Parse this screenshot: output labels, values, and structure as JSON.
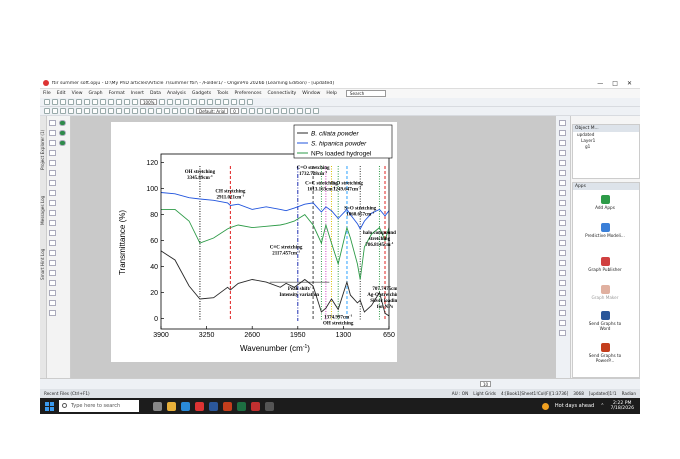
{
  "window": {
    "title": "ftir summer soft.opju - D:\\My PhD articles\\Article 7\\summer ftir\\ - /Folder1/ - OriginPro 2026b (Learning Edition) - [updated]",
    "min": "—",
    "max": "□",
    "close": "✕"
  },
  "menu": {
    "items": [
      "File",
      "Edit",
      "View",
      "Graph",
      "Format",
      "Insert",
      "Data",
      "Analysis",
      "Gadgets",
      "Tools",
      "Preferences",
      "Connectivity",
      "Window",
      "Help"
    ],
    "search_placeholder": "Search"
  },
  "toolbar": {
    "zoom": "100%",
    "font": "Default: Arial",
    "font_size": "0"
  },
  "left_tabs": [
    "Project Explorer (1)",
    "Messages Log",
    "Smart Hint Log"
  ],
  "object_manager": {
    "title": "Object M...",
    "nodes": [
      "updated",
      "Layer1",
      "g1",
      "",
      "",
      "",
      ""
    ]
  },
  "apps": {
    "title": "Apps",
    "items": [
      "Add Apps",
      "Predictive Modeli...",
      "Graph Publisher",
      "Graph Maker",
      "Send Graphs to Word",
      "Send Graphs to PowerP..."
    ]
  },
  "bottom": {
    "zoom_value": "10"
  },
  "status": {
    "left": "Recent Files (Ctrl+F1)",
    "items": [
      "AU : ON",
      "Light Grids",
      "4:[Book1]Sheet1!Col(F)[1:3736]",
      "3068",
      "[updated]1!1",
      "Radian"
    ]
  },
  "taskbar": {
    "search": "Type here to search",
    "weather": "Hot days ahead",
    "time": "2:22 PM",
    "date": "7/18/2026"
  },
  "chart_data": {
    "type": "line",
    "xlabel": "Wavenumber (cm",
    "xlabel_sup": "-1",
    "xlabel_end": ")",
    "ylabel": "Transmittance (%)",
    "xlim": [
      3900,
      650
    ],
    "ylim": [
      -5,
      122
    ],
    "xticks": [
      3900,
      3250,
      2600,
      1950,
      1300,
      650
    ],
    "yticks": [
      0,
      20,
      40,
      60,
      80,
      100,
      120
    ],
    "legend": [
      "B. ciliata powder",
      "S. hipanica powder",
      "NPs loaded hydrogel"
    ],
    "legend_position": "top-right",
    "series": [
      {
        "name": "B. ciliata powder",
        "color": "#2a2a2a",
        "x": [
          3900,
          3700,
          3500,
          3345,
          3150,
          2950,
          2911,
          2800,
          2600,
          2400,
          2200,
          2117,
          2000,
          1850,
          1732,
          1613,
          1550,
          1470,
          1374,
          1250,
          1200,
          1100,
          1060,
          1000,
          900,
          786,
          707,
          650
        ],
        "y": [
          52,
          45,
          25,
          15,
          16,
          24,
          22,
          27,
          30,
          28,
          24,
          27,
          24,
          30,
          25,
          5,
          8,
          15,
          7,
          28,
          18,
          12,
          14,
          5,
          10,
          20,
          4,
          2
        ]
      },
      {
        "name": "S. hipanica powder",
        "color": "#2255dd",
        "x": [
          3900,
          3700,
          3500,
          3345,
          3150,
          2950,
          2911,
          2800,
          2600,
          2400,
          2200,
          2117,
          2000,
          1850,
          1732,
          1613,
          1550,
          1470,
          1374,
          1250,
          1200,
          1100,
          1060,
          1000,
          900,
          786,
          707,
          650
        ],
        "y": [
          97,
          96,
          93,
          92,
          91,
          89,
          87,
          88,
          84,
          86,
          84,
          83,
          85,
          88,
          89,
          82,
          86,
          83,
          77,
          84,
          80,
          73,
          69,
          75,
          81,
          84,
          79,
          83
        ]
      },
      {
        "name": "NPs loaded hydrogel",
        "color": "#2e9b48",
        "x": [
          3900,
          3700,
          3500,
          3345,
          3150,
          2950,
          2911,
          2800,
          2600,
          2400,
          2200,
          2117,
          2000,
          1850,
          1732,
          1613,
          1550,
          1470,
          1374,
          1250,
          1200,
          1100,
          1060,
          1000,
          900,
          786,
          707,
          650
        ],
        "y": [
          84,
          84,
          75,
          58,
          62,
          69,
          70,
          72,
          70,
          71,
          72,
          73,
          75,
          80,
          72,
          58,
          72,
          58,
          42,
          70,
          62,
          42,
          30,
          55,
          65,
          70,
          60,
          70
        ]
      }
    ],
    "annotations": [
      {
        "x": 3345,
        "y": 112,
        "text": "OH stretching",
        "sub": "3345.89cm",
        "sup": "-1"
      },
      {
        "x": 2911,
        "y": 97,
        "text": "CH stretching",
        "sub": "2911.021cm",
        "sup": "-1"
      },
      {
        "x": 1732,
        "y": 115,
        "text": "C=O stretching",
        "sub": "1732.728cm",
        "sup": "-1"
      },
      {
        "x": 1613,
        "y": 103,
        "text": "C=C stretching",
        "sub": "1613.163cm",
        "sup": "-1"
      },
      {
        "x": 1249,
        "y": 103,
        "text": "C-O stretching",
        "sub": "1249.647cm",
        "sup": "-1"
      },
      {
        "x": 1060,
        "y": 84,
        "text": "S=O stretching",
        "sub": "1060.657cm",
        "sup": "-1"
      },
      {
        "x": 786,
        "y": 65,
        "text": "halo compound",
        "sub": "stretching",
        "sub2": "786.8145cm",
        "sup": "-1"
      },
      {
        "x": 2117,
        "y": 54,
        "text": "C≡C stretching",
        "sub": "2117.457cm",
        "sup": "-1"
      },
      {
        "x": 1930,
        "y": 22,
        "text": "Peak shift/",
        "sub": "Intensity variation"
      },
      {
        "x": 1374,
        "y": 0,
        "text": "1374.997cm",
        "sup": "-1",
        "sub": "OH stretching"
      },
      {
        "x": 707,
        "y": 22,
        "text": "707.7475cm",
        "sup": "-1",
        "sub": "Ag-O stretching/",
        "sub2": "Silver loading",
        "sub3": "for NPs"
      }
    ],
    "marker_lines": [
      {
        "x": 3345,
        "color": "#111111",
        "style": "dotted"
      },
      {
        "x": 2911,
        "color": "#e02020",
        "style": "dashed"
      },
      {
        "x": 1950,
        "color": "#2030b0",
        "style": "dashdot"
      },
      {
        "x": 1732,
        "color": "#444444",
        "style": "dashed"
      },
      {
        "x": 1613,
        "color": "#2e9b48",
        "style": "dotted"
      },
      {
        "x": 1550,
        "color": "#d040c0",
        "style": "dotted"
      },
      {
        "x": 1470,
        "color": "#d8c000",
        "style": "dotted"
      },
      {
        "x": 1374,
        "color": "#2e9b48",
        "style": "dotted"
      },
      {
        "x": 1249,
        "color": "#2aa0ff",
        "style": "dashed"
      },
      {
        "x": 1060,
        "color": "#333333",
        "style": "dotted"
      },
      {
        "x": 786,
        "color": "#2e9b48",
        "style": "dotted"
      },
      {
        "x": 707,
        "color": "#e02020",
        "style": "dashed"
      }
    ]
  }
}
